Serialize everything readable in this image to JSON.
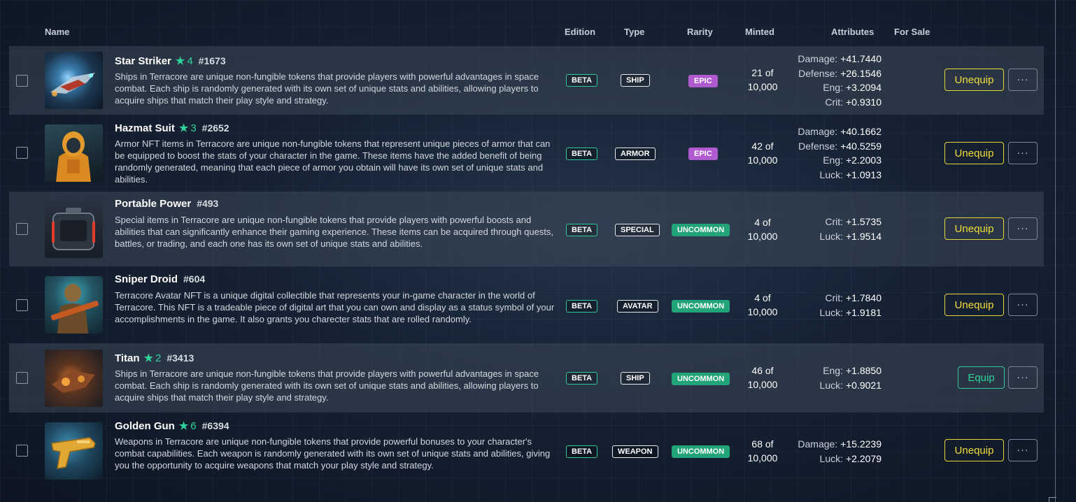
{
  "columns": {
    "name": "Name",
    "edition": "Edition",
    "type": "Type",
    "rarity": "Rarity",
    "minted": "Minted",
    "attributes": "Attributes",
    "for_sale": "For Sale"
  },
  "icons": {
    "level": "star-icon",
    "more": "more-icon"
  },
  "colors": {
    "accent": "#2fd39a",
    "unequip": "#f1dc3a",
    "epic": "#b05ad0",
    "uncommon": "#23a37a"
  },
  "rows": [
    {
      "name": "Star Striker",
      "level": "4",
      "id": "#1673",
      "description": "Ships in Terracore are unique non-fungible tokens that provide players with powerful advantages in space combat. Each ship is randomly generated with its own set of unique stats and abilities, allowing players to acquire ships that match their play style and strategy.",
      "edition": "BETA",
      "type": "SHIP",
      "rarity": "EPIC",
      "minted_count": "21 of",
      "minted_total": "10,000",
      "attributes": [
        {
          "key": "Damage:",
          "value": "+41.7440"
        },
        {
          "key": "Defense:",
          "value": "+26.1546"
        },
        {
          "key": "Eng:",
          "value": "+3.2094"
        },
        {
          "key": "Crit:",
          "value": "+0.9310"
        }
      ],
      "action": "Unequip",
      "more": "···"
    },
    {
      "name": "Hazmat Suit",
      "level": "3",
      "id": "#2652",
      "description": "Armor NFT items in Terracore are unique non-fungible tokens that represent unique pieces of armor that can be equipped to boost the stats of your character in the game. These items have the added benefit of being randomly generated, meaning that each piece of armor you obtain will have its own set of unique stats and abilities.",
      "edition": "BETA",
      "type": "ARMOR",
      "rarity": "EPIC",
      "minted_count": "42 of",
      "minted_total": "10,000",
      "attributes": [
        {
          "key": "Damage:",
          "value": "+40.1662"
        },
        {
          "key": "Defense:",
          "value": "+40.5259"
        },
        {
          "key": "Eng:",
          "value": "+2.2003"
        },
        {
          "key": "Luck:",
          "value": "+1.0913"
        }
      ],
      "action": "Unequip",
      "more": "···"
    },
    {
      "name": "Portable Power",
      "level": "",
      "id": "#493",
      "description": "Special items in Terracore are unique non-fungible tokens that provide players with powerful boosts and abilities that can significantly enhance their gaming experience. These items can be acquired through quests, battles, or trading, and each one has its own set of unique stats and abilities.",
      "edition": "BETA",
      "type": "SPECIAL",
      "rarity": "UNCOMMON",
      "minted_count": "4 of",
      "minted_total": "10,000",
      "attributes": [
        {
          "key": "Crit:",
          "value": "+1.5735"
        },
        {
          "key": "Luck:",
          "value": "+1.9514"
        }
      ],
      "action": "Unequip",
      "more": "···"
    },
    {
      "name": "Sniper Droid",
      "level": "",
      "id": "#604",
      "description": "Terracore Avatar NFT is a unique digital collectible that represents your in-game character in the world of Terracore. This NFT is a tradeable piece of digital art that you can own and display as a status symbol of your accomplishments in the game. It also grants you charecter stats that are rolled randomly.",
      "edition": "BETA",
      "type": "AVATAR",
      "rarity": "UNCOMMON",
      "minted_count": "4 of",
      "minted_total": "10,000",
      "attributes": [
        {
          "key": "Crit:",
          "value": "+1.7840"
        },
        {
          "key": "Luck:",
          "value": "+1.9181"
        }
      ],
      "action": "Unequip",
      "more": "···"
    },
    {
      "name": "Titan",
      "level": "2",
      "id": "#3413",
      "description": "Ships in Terracore are unique non-fungible tokens that provide players with powerful advantages in space combat. Each ship is randomly generated with its own set of unique stats and abilities, allowing players to acquire ships that match their play style and strategy.",
      "edition": "BETA",
      "type": "SHIP",
      "rarity": "UNCOMMON",
      "minted_count": "46 of",
      "minted_total": "10,000",
      "attributes": [
        {
          "key": "Eng:",
          "value": "+1.8850"
        },
        {
          "key": "Luck:",
          "value": "+0.9021"
        }
      ],
      "action": "Equip",
      "more": "···"
    },
    {
      "name": "Golden Gun",
      "level": "6",
      "id": "#6394",
      "description": "Weapons in Terracore are unique non-fungible tokens that provide powerful bonuses to your character's combat capabilities. Each weapon is randomly generated with its own set of unique stats and abilities, giving you the opportunity to acquire weapons that match your play style and strategy.",
      "edition": "BETA",
      "type": "WEAPON",
      "rarity": "UNCOMMON",
      "minted_count": "68 of",
      "minted_total": "10,000",
      "attributes": [
        {
          "key": "Damage:",
          "value": "+15.2239"
        },
        {
          "key": "Luck:",
          "value": "+2.2079"
        }
      ],
      "action": "Unequip",
      "more": "···"
    }
  ]
}
